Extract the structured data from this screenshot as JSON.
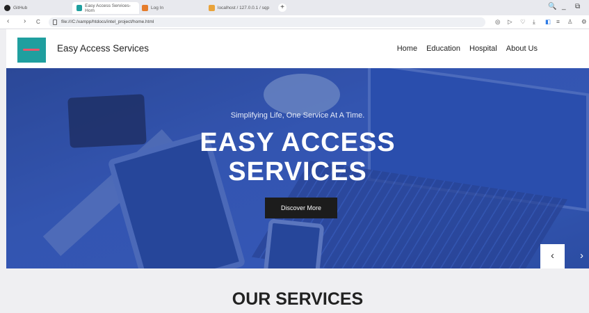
{
  "browser": {
    "tabs": [
      {
        "label": "GitHub"
      },
      {
        "label": "Easy Access Services-Hom"
      },
      {
        "label": "Log In"
      },
      {
        "label": "localhost / 127.0.0.1 / sqp"
      }
    ],
    "new_tab": "+",
    "window_controls": {
      "search": "🔍",
      "minimize": "_",
      "restore": "⧉"
    },
    "url": "file:///C:/xampp/htdocs/intel_project/home.html",
    "nav": {
      "back": "‹",
      "forward": "›",
      "reload": "C"
    },
    "toolbar_icons": [
      "camera-icon",
      "play-icon",
      "heart-icon",
      "download-icon",
      "sidebar-icon",
      "menu-icon",
      "profile-icon",
      "settings-icon"
    ]
  },
  "site": {
    "brand": "Easy Access Services",
    "menu": [
      "Home",
      "Education",
      "Hospital",
      "About Us"
    ]
  },
  "hero": {
    "tagline": "Simplifying Life, One Service At A Time.",
    "headline_line1": "EASY ACCESS",
    "headline_line2": "SERVICES",
    "cta": "Discover More",
    "prev": "‹",
    "next": "›"
  },
  "services": {
    "title": "OUR SERVICES"
  },
  "colors": {
    "logo": "#1f9f9f",
    "hero_tint": "#3a60c6",
    "cta": "#1c1c1c"
  }
}
